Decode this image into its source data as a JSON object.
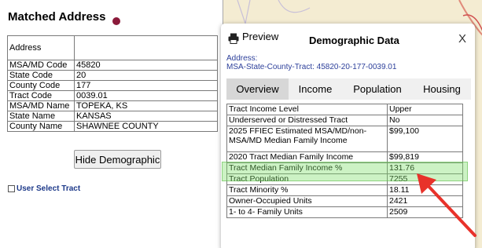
{
  "left": {
    "title": "Matched Address",
    "rows": [
      {
        "label": "Address",
        "value": ""
      },
      {
        "label": "MSA/MD Code",
        "value": "45820"
      },
      {
        "label": "State Code",
        "value": "20"
      },
      {
        "label": "County Code",
        "value": "177"
      },
      {
        "label": "Tract Code",
        "value": "0039.01"
      },
      {
        "label": "MSA/MD Name",
        "value": "TOPEKA, KS"
      },
      {
        "label": "State Name",
        "value": "KANSAS"
      },
      {
        "label": "County Name",
        "value": "SHAWNEE COUNTY"
      }
    ],
    "hide_button": "Hide Demographic",
    "user_select": "User Select Tract"
  },
  "popup": {
    "preview": "Preview",
    "title": "Demographic Data",
    "close": "X",
    "address_label": "Address:",
    "address_value": "MSA-State-County-Tract: 45820-20-177-0039.01",
    "tabs": [
      "Overview",
      "Income",
      "Population",
      "Housing"
    ],
    "active_tab": "Overview",
    "rows": [
      {
        "label": "Tract Income Level",
        "value": "Upper"
      },
      {
        "label": "Underserved or Distressed Tract",
        "value": "No"
      },
      {
        "label": "2025 FFIEC Estimated MSA/MD/non-MSA/MD Median Family Income",
        "value": "$99,100"
      },
      {
        "label": "2020 Tract Median Family Income",
        "value": "$99,819"
      },
      {
        "label": "Tract Median Family Income %",
        "value": "131.76"
      },
      {
        "label": "Tract Population",
        "value": "7255"
      },
      {
        "label": "Tract Minority %",
        "value": "18.11"
      },
      {
        "label": "Owner-Occupied Units",
        "value": "2421"
      },
      {
        "label": "1- to 4- Family Units",
        "value": "2509"
      }
    ]
  },
  "colors": {
    "status_dot": "#8b1a3a",
    "highlight": "#78dc64",
    "arrow": "#e8322a",
    "link": "#2c3f9a"
  },
  "icons": [
    "printer-icon",
    "close-icon",
    "arrow-annotation"
  ]
}
